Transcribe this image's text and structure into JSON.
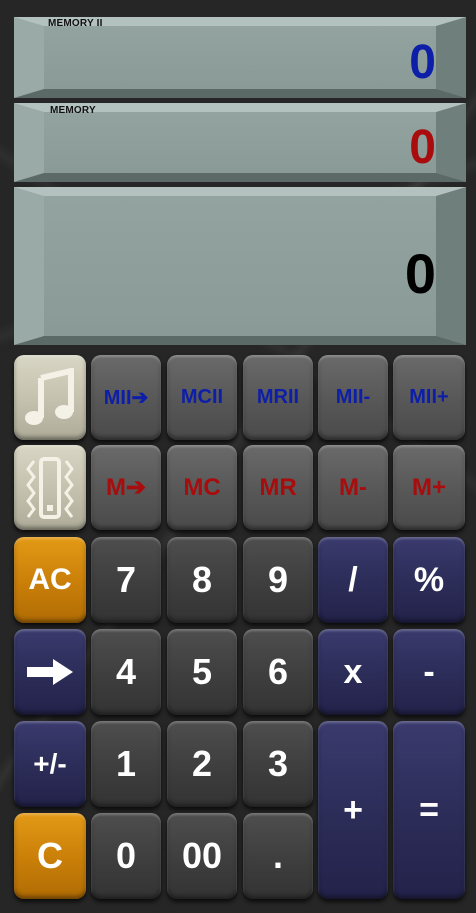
{
  "displays": {
    "memory2": {
      "label": "MEMORY II",
      "value": "0",
      "color": "#0d1ea8"
    },
    "memory": {
      "label": "MEMORY",
      "value": "0",
      "color": "#a80c0c"
    },
    "main": {
      "value": "0",
      "color": "#000000"
    }
  },
  "icons": {
    "music": "music-note-icon",
    "vibrate": "vibrate-icon",
    "arrow": "arrow-right-icon"
  },
  "keys": {
    "mii_store": "MII➔",
    "mcii": "MCII",
    "mrii": "MRII",
    "mii_minus": "MII-",
    "mii_plus": "MII+",
    "m_store": "M➔",
    "mc": "MC",
    "mr": "MR",
    "m_minus": "M-",
    "m_plus": "M+",
    "ac": "AC",
    "seven": "7",
    "eight": "8",
    "nine": "9",
    "divide": "/",
    "percent": "%",
    "four": "4",
    "five": "5",
    "six": "6",
    "multiply": "x",
    "minus": "-",
    "plus_minus": "+/-",
    "one": "1",
    "two": "2",
    "three": "3",
    "plus": "+",
    "equals": "=",
    "clear": "C",
    "zero": "0",
    "double_zero": "00",
    "decimal": "."
  }
}
